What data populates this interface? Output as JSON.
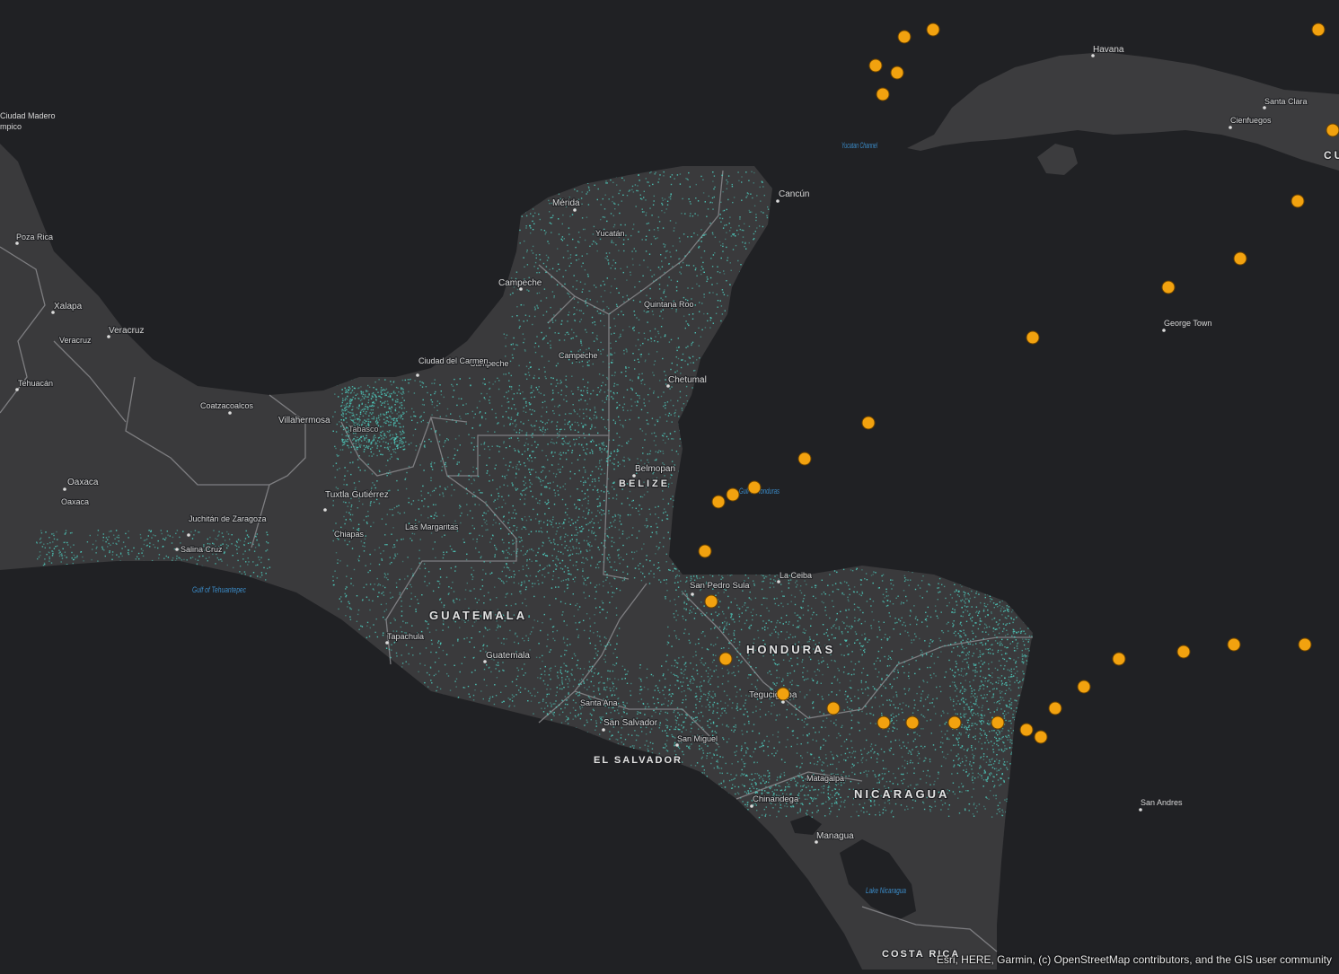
{
  "map": {
    "colors": {
      "ocean": "#202124",
      "land": "#3a3a3c",
      "boundary": "#8b8b8e",
      "label": "#d6d6d6",
      "water_label": "#3b8cc9",
      "marker": "#f2a20f",
      "marker_stroke": "#6b4300",
      "density": "#4fd3c4"
    },
    "city_labels": [
      {
        "id": "havana",
        "text": "Havana"
      },
      {
        "id": "santa-clara",
        "text": "Santa Clara"
      },
      {
        "id": "cienfuegos",
        "text": "Cienfuegos"
      },
      {
        "id": "ciudad-madero",
        "text": "Ciudad Madero"
      },
      {
        "id": "tampico",
        "text": "mpico"
      },
      {
        "id": "poza-rica",
        "text": "Poza Rica"
      },
      {
        "id": "xalapa",
        "text": "Xalapa"
      },
      {
        "id": "veracruz-city",
        "text": "Veracruz"
      },
      {
        "id": "veracruz-state",
        "text": "Veracruz"
      },
      {
        "id": "tehuacan",
        "text": "Tehuacán"
      },
      {
        "id": "coatzacoalcos",
        "text": "Coatzacoalcos"
      },
      {
        "id": "villahermosa",
        "text": "Villahermosa"
      },
      {
        "id": "tabasco",
        "text": "Tabasco"
      },
      {
        "id": "oaxaca-city",
        "text": "Oaxaca"
      },
      {
        "id": "oaxaca-state",
        "text": "Oaxaca"
      },
      {
        "id": "juchitan",
        "text": "Juchitán de Zaragoza"
      },
      {
        "id": "salina-cruz",
        "text": "Salina Cruz"
      },
      {
        "id": "tuxtla",
        "text": "Tuxtla Gutiérrez"
      },
      {
        "id": "chiapas",
        "text": "Chiapas"
      },
      {
        "id": "las-margaritas",
        "text": "Las Margaritas"
      },
      {
        "id": "tapachula",
        "text": "Tapachula"
      },
      {
        "id": "merida",
        "text": "Mérida"
      },
      {
        "id": "yucatan",
        "text": "Yucatán"
      },
      {
        "id": "cancun",
        "text": "Cancún"
      },
      {
        "id": "campeche-city",
        "text": "Campeche"
      },
      {
        "id": "campeche-state",
        "text": "Campeche"
      },
      {
        "id": "campeche-state2",
        "text": "Campeche"
      },
      {
        "id": "ciudad-del-carmen",
        "text": "Ciudad del Carmen"
      },
      {
        "id": "quintana-roo",
        "text": "Quintana Roo"
      },
      {
        "id": "chetumal",
        "text": "Chetumal"
      },
      {
        "id": "belmopan",
        "text": "Belmopan"
      },
      {
        "id": "guatemala-city",
        "text": "Guatemala"
      },
      {
        "id": "la-ceiba",
        "text": "La Ceiba"
      },
      {
        "id": "san-pedro-sula",
        "text": "San Pedro Sula"
      },
      {
        "id": "tegucigalpa",
        "text": "Tegucigalpa"
      },
      {
        "id": "santa-ana",
        "text": "Santa Ana"
      },
      {
        "id": "san-salvador",
        "text": "San Salvador"
      },
      {
        "id": "san-miguel",
        "text": "San Miguel"
      },
      {
        "id": "matagalpa",
        "text": "Matagalpa"
      },
      {
        "id": "chinandega",
        "text": "Chinandega"
      },
      {
        "id": "managua",
        "text": "Managua"
      },
      {
        "id": "george-town",
        "text": "George Town"
      },
      {
        "id": "san-andres",
        "text": "San Andres"
      }
    ],
    "country_labels": [
      {
        "id": "belize",
        "text": "BELIZE"
      },
      {
        "id": "guatemala",
        "text": "GUATEMALA"
      },
      {
        "id": "honduras",
        "text": "HONDURAS"
      },
      {
        "id": "el-salvador",
        "text": "EL SALVADOR"
      },
      {
        "id": "nicaragua",
        "text": "NICARAGUA"
      },
      {
        "id": "costa-rica",
        "text": "COSTA RICA"
      },
      {
        "id": "cuba",
        "text": "CU"
      }
    ],
    "water_labels": [
      {
        "id": "yucatan-channel",
        "text": "Yucatan Channel"
      },
      {
        "id": "gulf-of-honduras",
        "text": "Gulf of Honduras"
      },
      {
        "id": "gulf-of-tehuantepec",
        "text": "Gulf of Tehuantepec"
      },
      {
        "id": "lake-nicaragua",
        "text": "Lake Nicaragua"
      }
    ],
    "attribution": "Esri, HERE, Garmin, (c) OpenStreetMap contributors, and the GIS user community"
  }
}
